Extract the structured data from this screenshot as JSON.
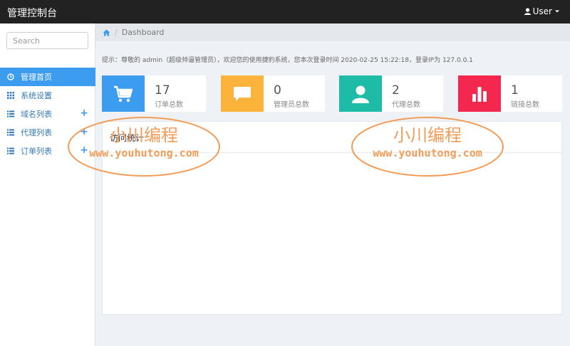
{
  "header": {
    "title": "管理控制台",
    "user_label": "User"
  },
  "sidebar": {
    "search_placeholder": "Search",
    "items": [
      {
        "label": "管理首页",
        "icon": "dashboard-icon",
        "active": true,
        "expandable": false
      },
      {
        "label": "系统设置",
        "icon": "grid-icon",
        "active": false,
        "expandable": false
      },
      {
        "label": "域名列表",
        "icon": "list-icon",
        "active": false,
        "expandable": true
      },
      {
        "label": "代理列表",
        "icon": "list-icon",
        "active": false,
        "expandable": true
      },
      {
        "label": "订单列表",
        "icon": "list-icon",
        "active": false,
        "expandable": true
      }
    ],
    "expand_symbol": "+"
  },
  "breadcrumb": {
    "separator": "/",
    "current": "Dashboard"
  },
  "notice": "提示：尊敬的 admin（超级帅逼管理员），欢迎您的使用捷豹系统，您本次登录时间 2020-02-25 15:22:18，登录IP为 127.0.0.1",
  "stats": [
    {
      "value": "17",
      "label": "订单总数",
      "color": "#3c9cf0",
      "icon": "cart-icon"
    },
    {
      "value": "0",
      "label": "管理员总数",
      "color": "#fbb33c",
      "icon": "chat-icon"
    },
    {
      "value": "2",
      "label": "代理总数",
      "color": "#1ebba6",
      "icon": "user-icon"
    },
    {
      "value": "1",
      "label": "链接总数",
      "color": "#f4284e",
      "icon": "bar-chart-icon"
    }
  ],
  "panel": {
    "title": "访问统计"
  },
  "watermark": {
    "name": "小川编程",
    "url": "www.youhutong.com",
    "color": "#f29d59"
  }
}
